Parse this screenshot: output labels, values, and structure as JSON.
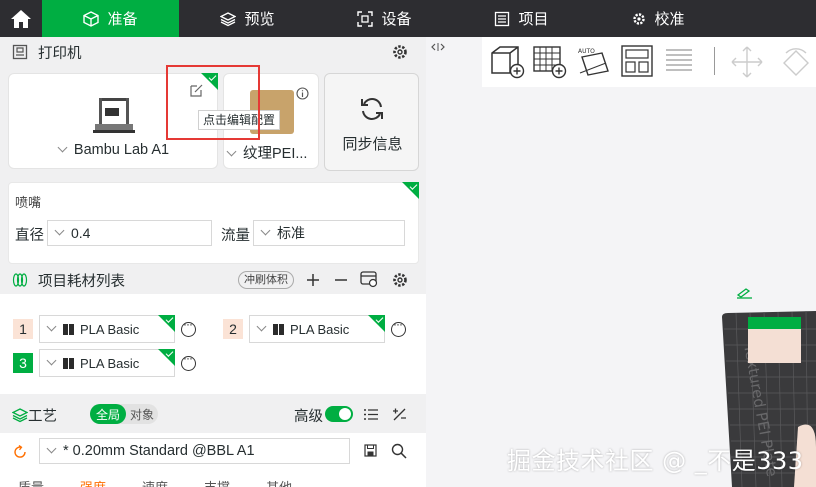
{
  "nav": {
    "tabs": [
      {
        "label": "准备",
        "active": true
      },
      {
        "label": "预览",
        "active": false
      },
      {
        "label": "设备",
        "active": false
      },
      {
        "label": "项目",
        "active": false
      },
      {
        "label": "校准",
        "active": false
      }
    ]
  },
  "printer": {
    "title": "打印机",
    "printer_name": "Bambu Lab A1",
    "plate_name": "纹理PEI...",
    "sync_label": "同步信息",
    "tooltip": "点击编辑配置"
  },
  "nozzle": {
    "section": "喷嘴",
    "diameter_label": "直径",
    "diameter_value": "0.4",
    "flow_label": "流量",
    "flow_value": "标准"
  },
  "filaments": {
    "title": "项目耗材列表",
    "flush_label": "冲刷体积",
    "items": [
      {
        "num": "1",
        "name": "PLA Basic"
      },
      {
        "num": "2",
        "name": "PLA Basic"
      },
      {
        "num": "3",
        "name": "PLA Basic"
      }
    ]
  },
  "process": {
    "title": "工艺",
    "global_label": "全局",
    "object_label": "对象",
    "advanced_label": "高级",
    "preset": "* 0.20mm Standard @BBL A1",
    "subtabs": [
      "质量",
      "强度",
      "速度",
      "支撑",
      "其他"
    ]
  },
  "plate_label": "Textured PEI Plate",
  "watermark": "掘金技术社区 @ _不是333",
  "colors": {
    "accent": "#00ae42",
    "topbar": "#2d2d31",
    "highlight_box": "#e53935"
  }
}
